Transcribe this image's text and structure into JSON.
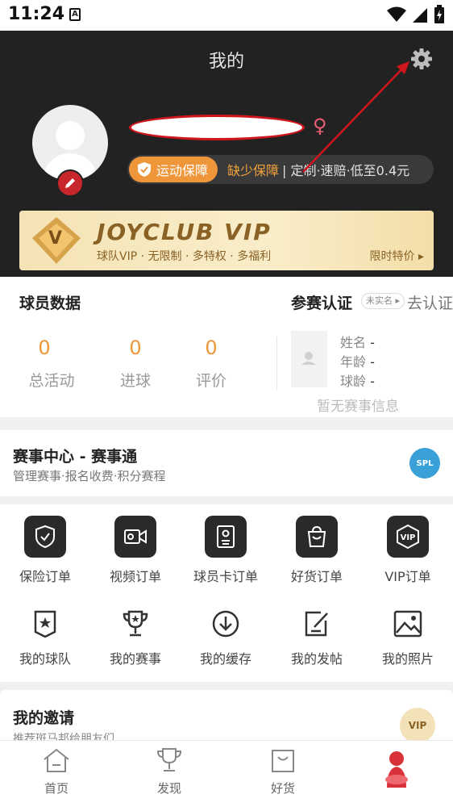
{
  "status_bar": {
    "time": "11:24",
    "a_badge": "A"
  },
  "header": {
    "title": "我的",
    "gender_symbol": "♀"
  },
  "insurance": {
    "pill_label": "运动保障",
    "lack_text": "缺少保障",
    "promo_text": "| 定制·速赔·低至0.4元"
  },
  "vip_banner": {
    "brand": "JOYCLUB VIP",
    "subtitle": "球队VIP · 无限制 · 多特权 · 多福利",
    "deal": "限时特价 ▸",
    "logo_letter": "V"
  },
  "player_stats": {
    "title": "球员数据",
    "items": [
      {
        "value": "0",
        "label": "总活动"
      },
      {
        "value": "0",
        "label": "进球"
      },
      {
        "value": "0",
        "label": "评价"
      }
    ]
  },
  "certification": {
    "title": "参赛认证",
    "tag": "未实名 ▸",
    "link": "去认证",
    "name_label": "姓名",
    "age_label": "年龄",
    "years_label": "球龄",
    "placeholder": "-",
    "empty": "暂无赛事信息"
  },
  "event_center": {
    "title": "赛事中心 - 赛事通",
    "subtitle": "管理赛事·报名收费·积分赛程",
    "logo_text": "SPL"
  },
  "orders": [
    {
      "label": "保险订单",
      "icon": "shield-check-icon"
    },
    {
      "label": "视频订单",
      "icon": "video-camera-icon"
    },
    {
      "label": "球员卡订单",
      "icon": "player-card-icon"
    },
    {
      "label": "好货订单",
      "icon": "shopping-bag-icon"
    },
    {
      "label": "VIP订单",
      "icon": "vip-hexagon-icon"
    }
  ],
  "my_items": [
    {
      "label": "我的球队",
      "icon": "team-badge-icon"
    },
    {
      "label": "我的赛事",
      "icon": "trophy-icon"
    },
    {
      "label": "我的缓存",
      "icon": "download-icon"
    },
    {
      "label": "我的发帖",
      "icon": "edit-post-icon"
    },
    {
      "label": "我的照片",
      "icon": "photo-icon"
    }
  ],
  "invite": {
    "title": "我的邀请",
    "subtitle": "推荐斑马邦给朋友们",
    "badge": "VIP"
  },
  "tabbar": [
    {
      "label": "首页",
      "icon": "home-icon"
    },
    {
      "label": "发现",
      "icon": "trophy-icon"
    },
    {
      "label": "好货",
      "icon": "bag-icon"
    },
    {
      "label": "",
      "icon": "profile-mascot-icon"
    }
  ],
  "colors": {
    "accent_orange": "#f0963a",
    "header_bg": "#222222",
    "annotation_red": "#d0161c"
  }
}
